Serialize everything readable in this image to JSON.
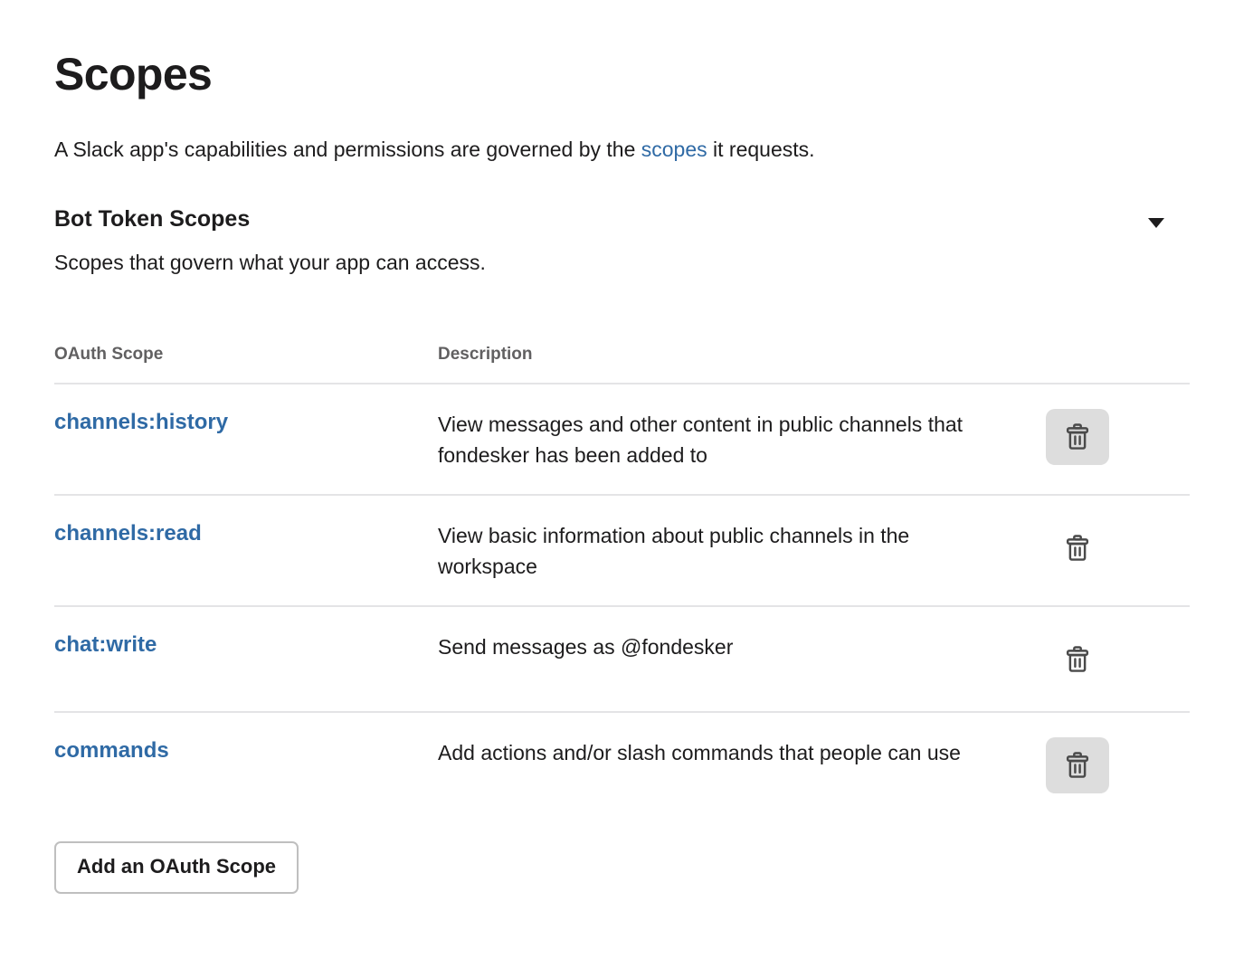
{
  "page": {
    "title": "Scopes",
    "intro_before": "A Slack app's capabilities and permissions are governed by the ",
    "intro_link": "scopes",
    "intro_after": " it requests."
  },
  "section": {
    "title": "Bot Token Scopes",
    "subtitle": "Scopes that govern what your app can access.",
    "collapse_icon": "chevron-down-icon"
  },
  "table": {
    "headers": {
      "scope": "OAuth Scope",
      "description": "Description"
    },
    "row_action_icon": "trash-icon",
    "rows": [
      {
        "scope": "channels:history",
        "description": "View messages and other content in public channels that fondesker has been added to",
        "delete_highlighted": true
      },
      {
        "scope": "channels:read",
        "description": "View basic information about public channels in the workspace",
        "delete_highlighted": false
      },
      {
        "scope": "chat:write",
        "description": "Send messages as @fondesker",
        "delete_highlighted": false
      },
      {
        "scope": "commands",
        "description": "Add actions and/or slash commands that people can use",
        "delete_highlighted": true
      }
    ]
  },
  "footer": {
    "add_scope_label": "Add an OAuth Scope"
  },
  "colors": {
    "link": "#2f6aa5",
    "text": "#1d1c1d",
    "muted": "#616061",
    "divider": "#e4e4e6",
    "button_hover_bg": "#dddddd"
  }
}
